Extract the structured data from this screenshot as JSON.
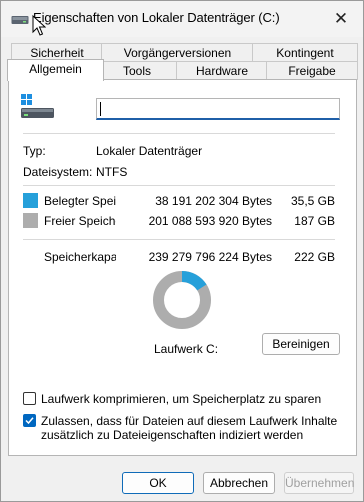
{
  "window": {
    "title": "Eigenschaften von Lokaler Datenträger (C:)"
  },
  "tabs": {
    "row_back": [
      "Sicherheit",
      "Vorgängerversionen",
      "Kontingent"
    ],
    "row_front": [
      "Allgemein",
      "Tools",
      "Hardware",
      "Freigabe"
    ],
    "active": "Allgemein"
  },
  "general": {
    "name_value": "",
    "type_label": "Typ:",
    "type_value": "Lokaler Datenträger",
    "fs_label": "Dateisystem:",
    "fs_value": "NTFS",
    "used": {
      "label": "Belegter Speicherplatz:",
      "bytes": "38 191 202 304 Bytes",
      "size": "35,5 GB",
      "color": "#26a0da"
    },
    "free": {
      "label": "Freier Speicherplatz:",
      "bytes": "201 088 593 920 Bytes",
      "size": "187 GB",
      "color": "#adadad"
    },
    "capacity": {
      "label": "Speicherkapazität:",
      "bytes": "239 279 796 224 Bytes",
      "size": "222 GB"
    },
    "used_fraction": 0.16,
    "drive_label": "Laufwerk C:",
    "cleanup_button": "Bereinigen",
    "compress_label": "Laufwerk komprimieren, um Speicherplatz zu sparen",
    "compress_checked": false,
    "index_label_line1": "Zulassen, dass für Dateien auf diesem Laufwerk Inhalte",
    "index_label_line2": "zusätzlich zu Dateieigenschaften indiziert werden",
    "index_checked": true
  },
  "footer": {
    "ok": "OK",
    "cancel": "Abbrechen",
    "apply": "Übernehmen"
  },
  "icons": [
    "drive-icon",
    "close-icon",
    "checkmark-icon",
    "mouse-cursor-icon"
  ]
}
